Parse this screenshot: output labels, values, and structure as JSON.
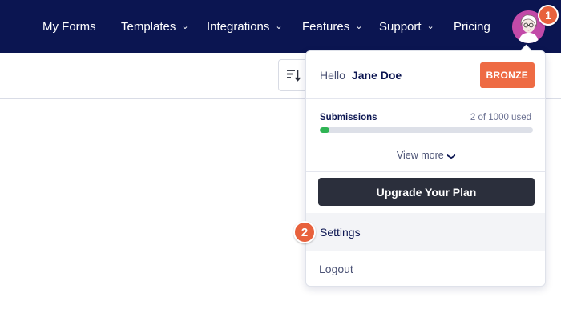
{
  "nav": {
    "items": [
      {
        "label": "My Forms",
        "has_dropdown": false
      },
      {
        "label": "Templates",
        "has_dropdown": true
      },
      {
        "label": "Integrations",
        "has_dropdown": true
      },
      {
        "label": "Features",
        "has_dropdown": true
      },
      {
        "label": "Support",
        "has_dropdown": true
      },
      {
        "label": "Pricing",
        "has_dropdown": false
      }
    ],
    "dropdown_glyph": "⌄",
    "avatar_icon": "user-avatar-illustration",
    "background": "#0b1551"
  },
  "toolbar": {
    "sort_icon": "sort-descending-icon"
  },
  "account_menu": {
    "hello_label": "Hello",
    "user_name": "Jane Doe",
    "plan_badge": "BRONZE",
    "submissions": {
      "title": "Submissions",
      "usage_text": "2 of 1000 used",
      "used": 2,
      "limit": 1000
    },
    "view_more_label": "View more",
    "upgrade_label": "Upgrade Your Plan",
    "settings_label": "Settings",
    "logout_label": "Logout"
  },
  "step_markers": {
    "first": "1",
    "second": "2"
  },
  "colors": {
    "accent_orange": "#ee6b44",
    "progress_green": "#2fb454",
    "dark_button": "#2b2f3c",
    "navy": "#0b1551"
  }
}
